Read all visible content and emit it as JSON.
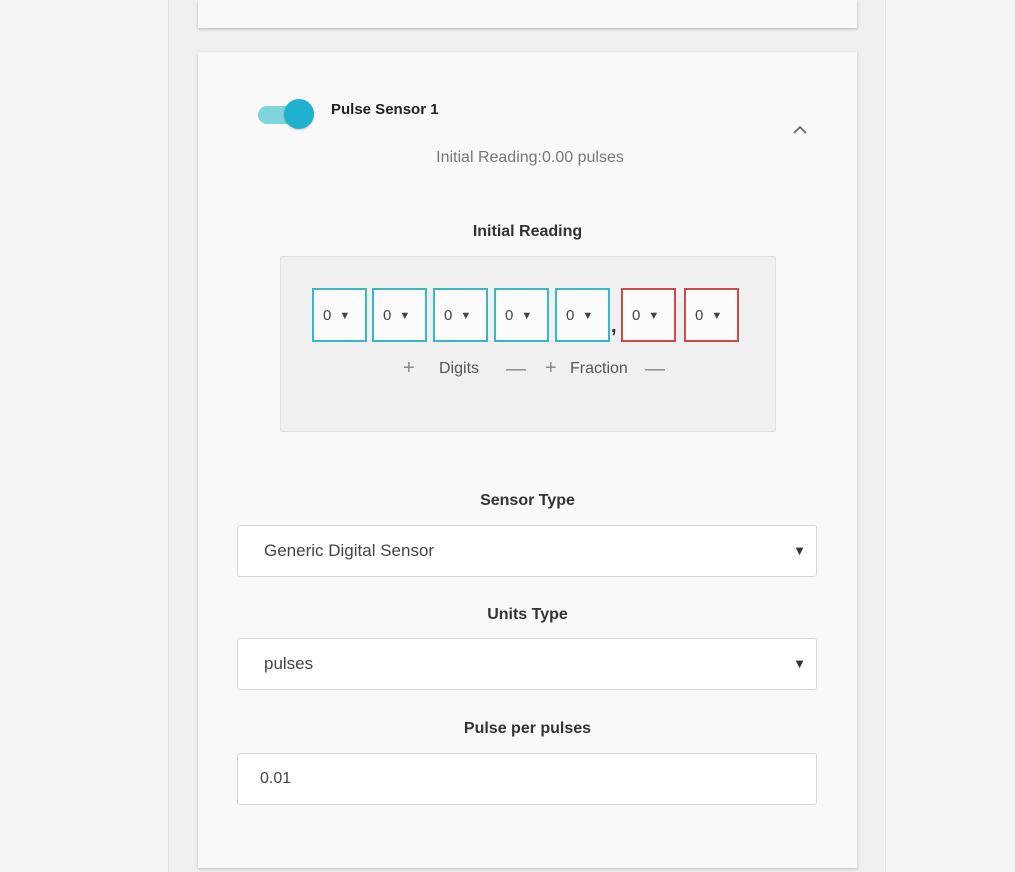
{
  "sensor": {
    "enabled": true,
    "title": "Pulse Sensor 1",
    "subtitle": "Initial Reading:0.00 pulses"
  },
  "initial_reading": {
    "label": "Initial Reading",
    "integer_digits": [
      "0",
      "0",
      "0",
      "0",
      "0"
    ],
    "fraction_digits": [
      "0",
      "0"
    ],
    "separator": ",",
    "controls": {
      "digits_plus": "+",
      "digits_label": "Digits",
      "digits_minus": "—",
      "fraction_plus": "+",
      "fraction_label": "Fraction",
      "fraction_minus": "—"
    }
  },
  "sensor_type": {
    "label": "Sensor Type",
    "value": "Generic Digital Sensor"
  },
  "units_type": {
    "label": "Units Type",
    "value": "pulses"
  },
  "pulse_per": {
    "label": "Pulse per pulses",
    "value": "0.01"
  },
  "icons": {
    "collapse": "chevron-up-icon",
    "dropdown": "triangle-down-icon"
  },
  "colors": {
    "accent": "#20b1cc",
    "integer_border": "#3bb6c5",
    "fraction_border": "#d04a4a"
  }
}
